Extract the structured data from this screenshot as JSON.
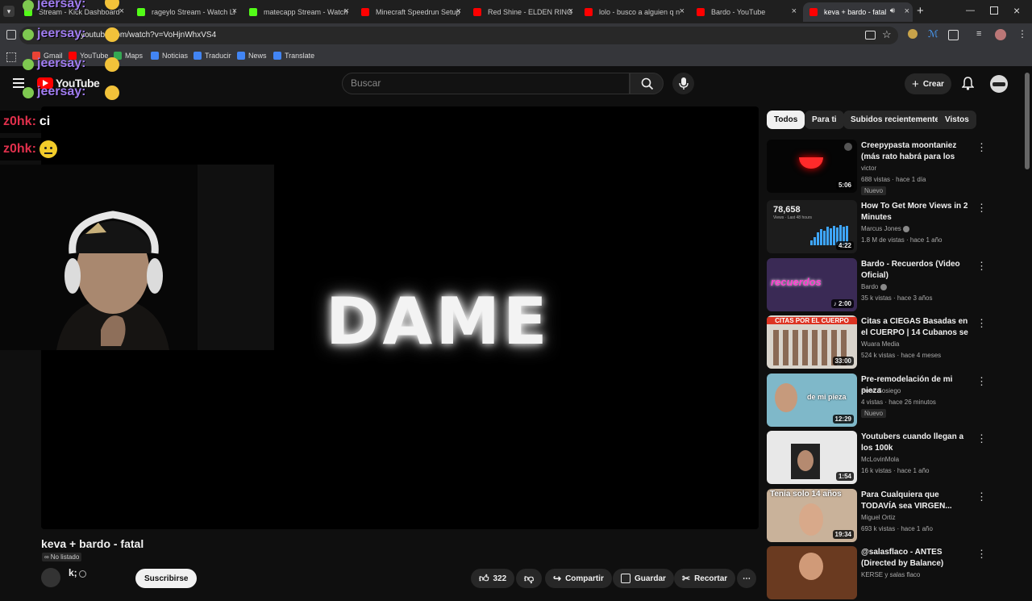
{
  "browser": {
    "tabs": [
      {
        "title": "Stream - Kick Dashboard",
        "color": "#53fc18"
      },
      {
        "title": "rageylo Stream - Watch Li",
        "color": "#53fc18"
      },
      {
        "title": "matecapp Stream - Watch",
        "color": "#53fc18"
      },
      {
        "title": "Minecraft Speedrun Setup",
        "color": "#ff0000"
      },
      {
        "title": "Red Shine - ELDEN RING",
        "color": "#ff0000"
      },
      {
        "title": "lolo - busco a alguien q n",
        "color": "#ff0000"
      },
      {
        "title": "Bardo - YouTube",
        "color": "#ff0000"
      },
      {
        "title": "keva + bardo - fatal",
        "color": "#ff0000"
      }
    ],
    "url": "youtube.com/watch?v=VoHjnWhxVS4",
    "bookmarks": [
      "Gmail",
      "YouTube",
      "Maps",
      "Noticias",
      "Traducir",
      "News",
      "Translate"
    ]
  },
  "overlay": {
    "username": "jeersay:",
    "chat": [
      {
        "user": "z0hk:",
        "message": "ci"
      },
      {
        "user": "z0hk:",
        "message": ""
      }
    ]
  },
  "youtube": {
    "logo": "YouTube",
    "search_placeholder": "Buscar",
    "create_label": "Crear",
    "accent": "#ff0000"
  },
  "video": {
    "frame_text": "DAME",
    "title": "keva + bardo - fatal",
    "visibility": "No listado",
    "channel": "k;",
    "subscribe": "Suscribirse",
    "likes": "322",
    "share": "Compartir",
    "save": "Guardar",
    "clip": "Recortar"
  },
  "filters": [
    "Todos",
    "Para ti",
    "Subidos recientemente",
    "Vistos"
  ],
  "recommendations": [
    {
      "title": "Creepypasta moontaniez (más rato habrá para los demás est...",
      "channel": "victor",
      "meta": "688 vistas · hace 1 día",
      "badge": "Nuevo",
      "duration": "5:06"
    },
    {
      "title": "How To Get More Views in 2 Minutes",
      "channel": "Marcus Jones",
      "meta": "1.8 M de vistas · hace 1 año",
      "badge": "",
      "duration": "4:22",
      "thumb_number": "78,658",
      "thumb_caption": "Views · Last 48 hours"
    },
    {
      "title": "Bardo - Recuerdos (Video Oficial)",
      "channel": "Bardo",
      "meta": "35 k vistas · hace 3 años",
      "badge": "",
      "duration": "2:00",
      "thumb_text": "recuerdos"
    },
    {
      "title": "Citas a CIEGAS Basadas en el CUERPO | 14 Cubanos se ...",
      "channel": "Wuara Media",
      "meta": "524 k vistas · hace 4 meses",
      "badge": "",
      "duration": "33:00",
      "thumb_text": "CITAS POR EL CUERPO"
    },
    {
      "title": "Pre-remodelación de mi pieza",
      "channel": "Sosa Sosiego",
      "meta": "4 vistas · hace 26 minutos",
      "badge": "Nuevo",
      "duration": "12:29",
      "thumb_text": "de mi pieza"
    },
    {
      "title": "Youtubers cuando llegan a los 100k",
      "channel": "McLovinMola",
      "meta": "16 k vistas · hace 1 año",
      "badge": "",
      "duration": "1:54"
    },
    {
      "title": "Para Cualquiera que TODAVÍA sea VIRGEN...",
      "channel": "Miguel Ortiz",
      "meta": "693 k vistas · hace 1 año",
      "badge": "",
      "duration": "19:34",
      "thumb_text": "Tenía solo 14 años"
    },
    {
      "title": "@salasflaco - ANTES (Directed by Balance)",
      "channel": "KERSE y salas flaco",
      "meta": "",
      "badge": "",
      "duration": ""
    }
  ]
}
